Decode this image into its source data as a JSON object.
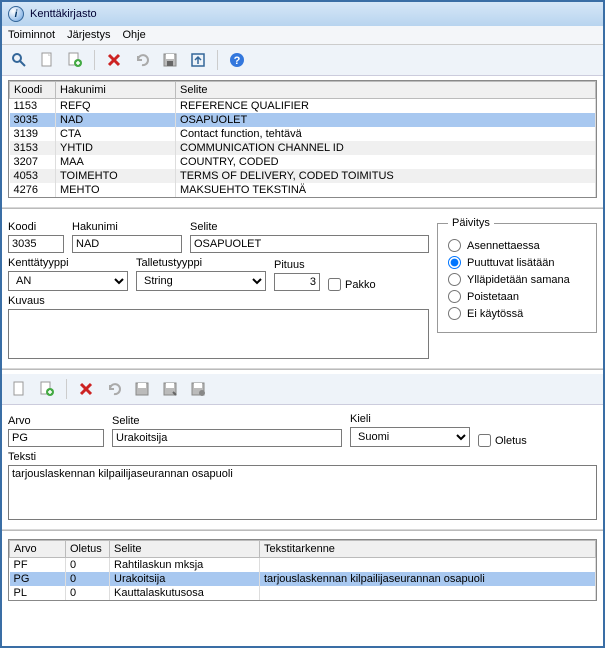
{
  "window": {
    "title": "Kenttäkirjasto"
  },
  "menu": {
    "toiminnot": "Toiminnot",
    "jarjestys": "Järjestys",
    "ohje": "Ohje"
  },
  "topGrid": {
    "headers": {
      "koodi": "Koodi",
      "hakunimi": "Hakunimi",
      "selite": "Selite"
    },
    "rows": [
      {
        "koodi": "1153",
        "hakunimi": "REFQ",
        "selite": "REFERENCE QUALIFIER"
      },
      {
        "koodi": "3035",
        "hakunimi": "NAD",
        "selite": "OSAPUOLET"
      },
      {
        "koodi": "3139",
        "hakunimi": "CTA",
        "selite": "Contact function, tehtävä"
      },
      {
        "koodi": "3153",
        "hakunimi": "YHTID",
        "selite": "COMMUNICATION CHANNEL ID"
      },
      {
        "koodi": "3207",
        "hakunimi": "MAA",
        "selite": "COUNTRY, CODED"
      },
      {
        "koodi": "4053",
        "hakunimi": "TOIMEHTO",
        "selite": "TERMS OF DELIVERY, CODED   TOIMITUS"
      },
      {
        "koodi": "4276",
        "hakunimi": "MEHTO",
        "selite": "MAKSUEHTO TEKSTINÄ"
      }
    ],
    "selectedIndex": 1
  },
  "form": {
    "labels": {
      "koodi": "Koodi",
      "hakunimi": "Hakunimi",
      "selite": "Selite",
      "kenttatyyppi": "Kenttätyyppi",
      "talletustyyppi": "Talletustyyppi",
      "pituus": "Pituus",
      "pakko": "Pakko",
      "kuvaus": "Kuvaus"
    },
    "values": {
      "koodi": "3035",
      "hakunimi": "NAD",
      "selite": "OSAPUOLET",
      "kenttatyyppi": "AN",
      "talletustyyppi": "String",
      "pituus": "3",
      "pakko": false,
      "kuvaus": ""
    }
  },
  "paivitys": {
    "legend": "Päivitys",
    "options": {
      "asennettaessa": "Asennettaessa",
      "puuttuvat": "Puuttuvat lisätään",
      "yllapidetaan": "Ylläpidetään samana",
      "poistetaan": "Poistetaan",
      "eikaytossa": "Ei käytössä"
    },
    "selected": "puuttuvat"
  },
  "arvoForm": {
    "labels": {
      "arvo": "Arvo",
      "selite": "Selite",
      "kieli": "Kieli",
      "oletus": "Oletus",
      "teksti": "Teksti"
    },
    "values": {
      "arvo": "PG",
      "selite": "Urakoitsija",
      "kieli": "Suomi",
      "oletus": false,
      "teksti": "tarjouslaskennan kilpailijaseurannan osapuoli"
    }
  },
  "bottomGrid": {
    "headers": {
      "arvo": "Arvo",
      "oletus": "Oletus",
      "selite": "Selite",
      "tekstitarkenne": "Tekstitarkenne"
    },
    "rows": [
      {
        "arvo": "PF",
        "oletus": "0",
        "selite": "Rahtilaskun mksja",
        "tekstitarkenne": ""
      },
      {
        "arvo": "PG",
        "oletus": "0",
        "selite": "Urakoitsija",
        "tekstitarkenne": "tarjouslaskennan kilpailijaseurannan osapuoli"
      },
      {
        "arvo": "PL",
        "oletus": "0",
        "selite": "Kauttalaskutusosa",
        "tekstitarkenne": ""
      }
    ],
    "selectedIndex": 1
  }
}
